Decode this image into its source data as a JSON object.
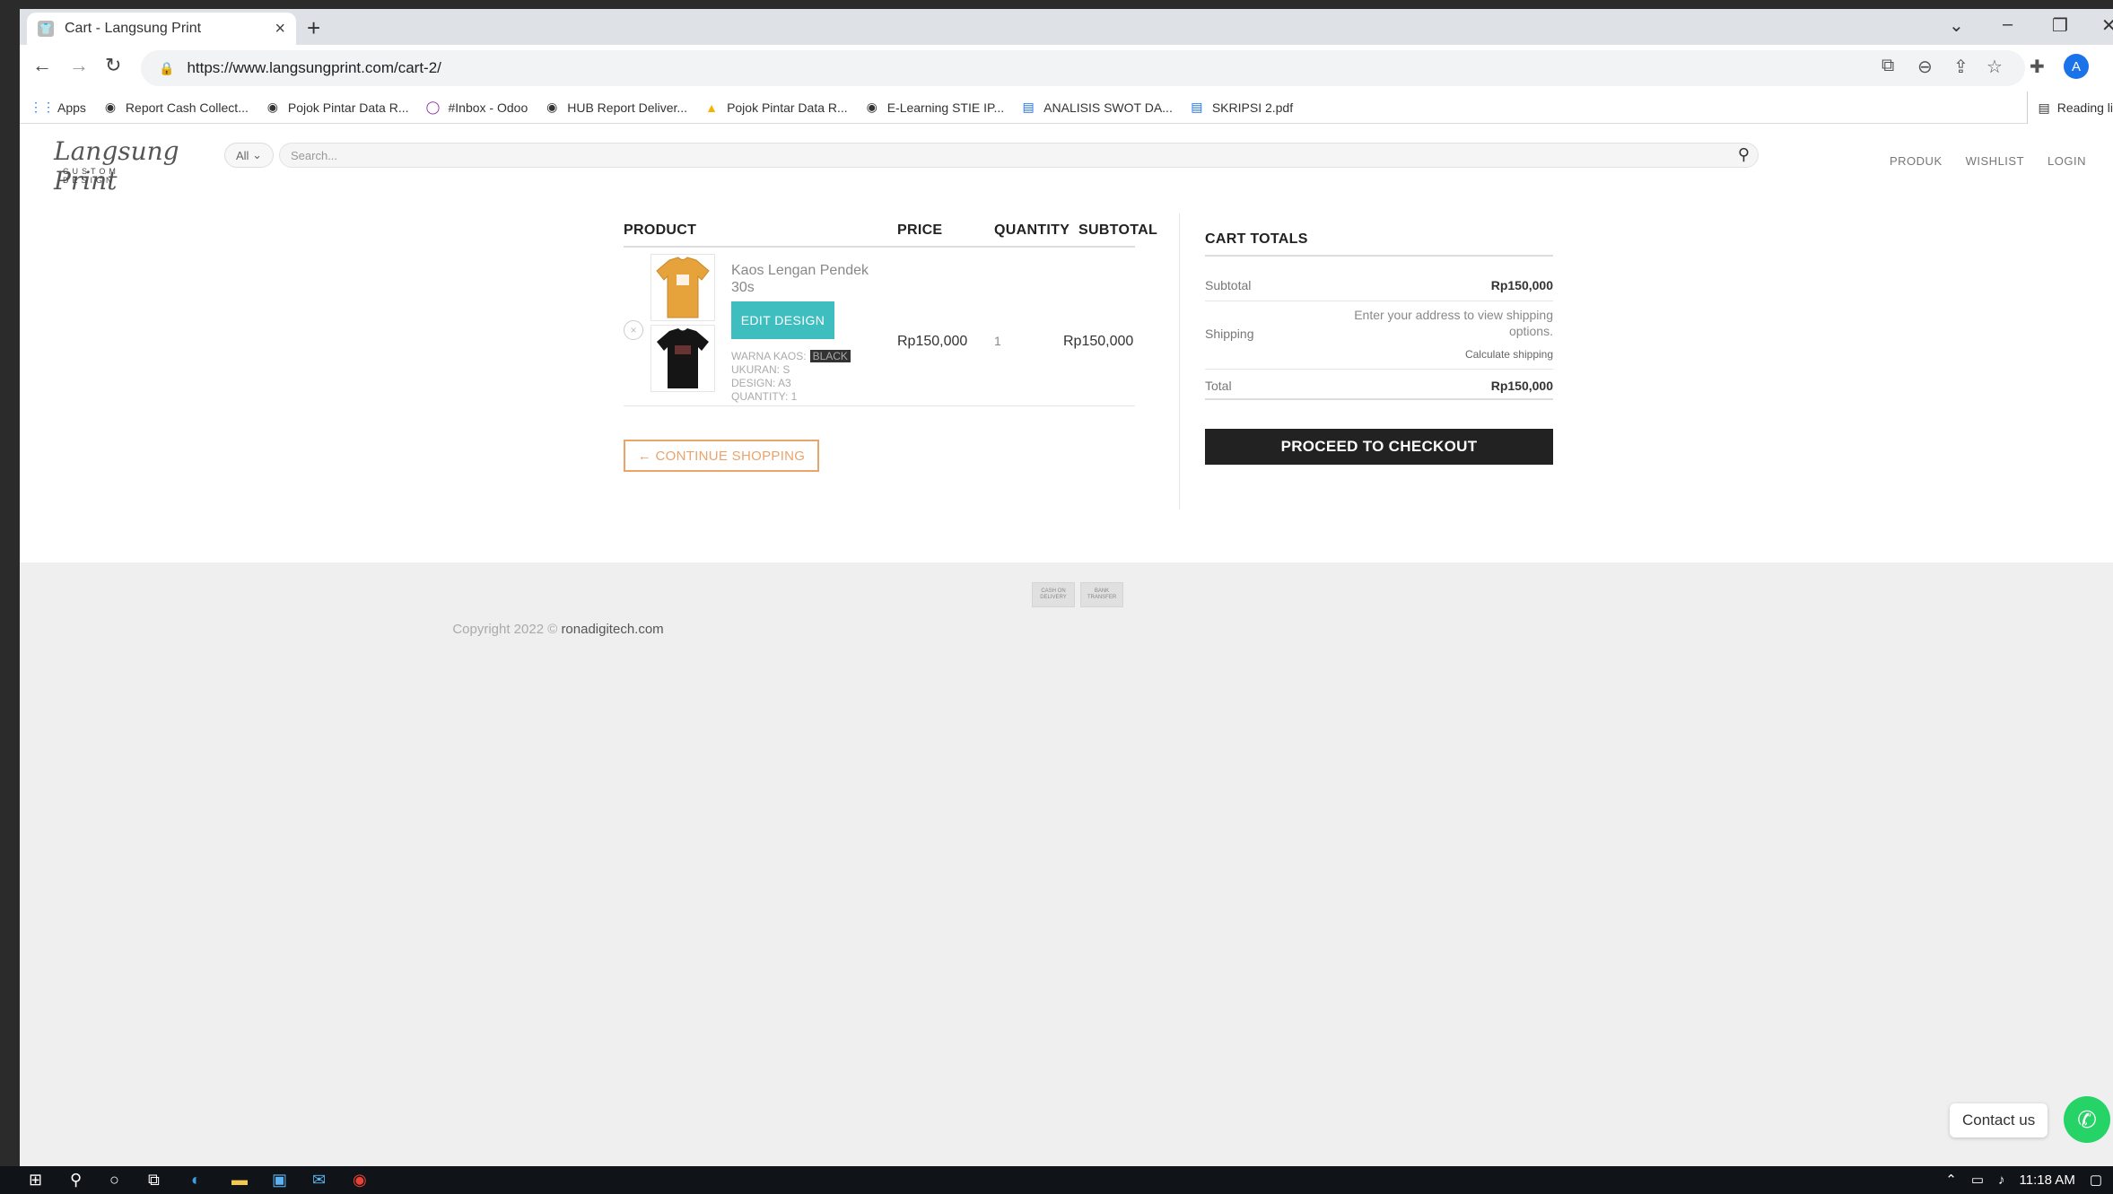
{
  "browser": {
    "tab_title": "Cart - Langsung Print",
    "url": "https://www.langsungprint.com/cart-2/",
    "profile_initial": "A",
    "bookmarks": [
      {
        "label": "Apps",
        "icon": "apps-grid-icon"
      },
      {
        "label": "Report Cash Collect...",
        "icon": "globe-icon"
      },
      {
        "label": "Pojok Pintar Data R...",
        "icon": "globe-icon"
      },
      {
        "label": "#Inbox - Odoo",
        "icon": "odoo-icon"
      },
      {
        "label": "HUB Report Deliver...",
        "icon": "globe-icon"
      },
      {
        "label": "Pojok Pintar Data R...",
        "icon": "drive-icon"
      },
      {
        "label": "E-Learning STIE IP...",
        "icon": "globe-icon"
      },
      {
        "label": "ANALISIS SWOT DA...",
        "icon": "doc-icon"
      },
      {
        "label": "SKRIPSI 2.pdf",
        "icon": "doc-icon"
      }
    ],
    "reading_list": "Reading li"
  },
  "site": {
    "logo_text": "Langsung Print",
    "logo_sub": "CUSTOM DESIGN",
    "search": {
      "category": "All",
      "placeholder": "Search..."
    },
    "nav": [
      "PRODUK",
      "WISHLIST",
      "LOGIN"
    ]
  },
  "cart": {
    "headers": {
      "product": "PRODUCT",
      "price": "PRICE",
      "quantity": "QUANTITY",
      "subtotal": "SUBTOTAL"
    },
    "item": {
      "name": "Kaos Lengan Pendek 30s",
      "edit_label": "EDIT DESIGN",
      "warna_label": "WARNA KAOS:",
      "warna_value": "BLACK",
      "ukuran": "UKURAN: S",
      "design": "DESIGN: A3",
      "quantity_meta": "QUANTITY: 1",
      "price": "Rp150,000",
      "qty": "1",
      "subtotal": "Rp150,000",
      "front_color": "#e6a33c",
      "back_color": "#151515"
    },
    "continue_label": "← CONTINUE SHOPPING"
  },
  "totals": {
    "title": "CART TOTALS",
    "subtotal_label": "Subtotal",
    "subtotal_value": "Rp150,000",
    "shipping_label": "Shipping",
    "shipping_note": "Enter your address to view shipping options.",
    "calc_shipping": "Calculate shipping",
    "total_label": "Total",
    "total_value": "Rp150,000",
    "checkout_label": "PROCEED TO CHECKOUT"
  },
  "footer": {
    "badges": [
      "CASH ON DELIVERY",
      "BANK TRANSFER"
    ],
    "copyright_prefix": "Copyright 2022 ©",
    "copyright_link": "ronadigitech.com"
  },
  "contact": {
    "label": "Contact us"
  },
  "taskbar": {
    "time": "11:18 AM"
  },
  "colors": {
    "accent": "#3fbec0",
    "continue": "#e9a46a",
    "checkout": "#222222",
    "whatsapp": "#25d366"
  }
}
